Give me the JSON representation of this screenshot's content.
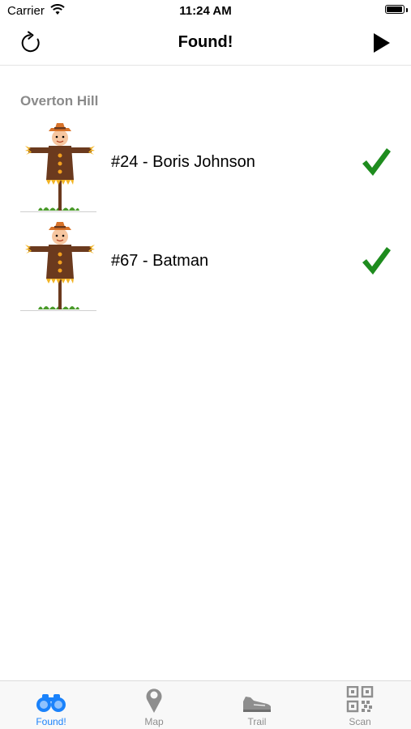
{
  "status_bar": {
    "carrier": "Carrier",
    "time": "11:24 AM",
    "battery_level": 0.95
  },
  "nav": {
    "title": "Found!",
    "left_icon": "refresh-icon",
    "right_icon": "play-icon"
  },
  "section": {
    "title": "Overton Hill"
  },
  "items": [
    {
      "label": "#24 - Boris Johnson",
      "image": "scarecrow-image",
      "status_icon": "checkmark-icon"
    },
    {
      "label": "#67 - Batman",
      "image": "scarecrow-image",
      "status_icon": "checkmark-icon"
    }
  ],
  "tabs": [
    {
      "label": "Found!",
      "icon": "binoculars-icon",
      "active": true
    },
    {
      "label": "Map",
      "icon": "map-pin-icon",
      "active": false
    },
    {
      "label": "Trail",
      "icon": "shoe-icon",
      "active": false
    },
    {
      "label": "Scan",
      "icon": "qr-code-icon",
      "active": false
    }
  ],
  "colors": {
    "accent": "#1a82fb",
    "inactive_tab": "#8e8e8e",
    "check_green": "#1e8c1e",
    "section_header": "#8a8a8a"
  }
}
